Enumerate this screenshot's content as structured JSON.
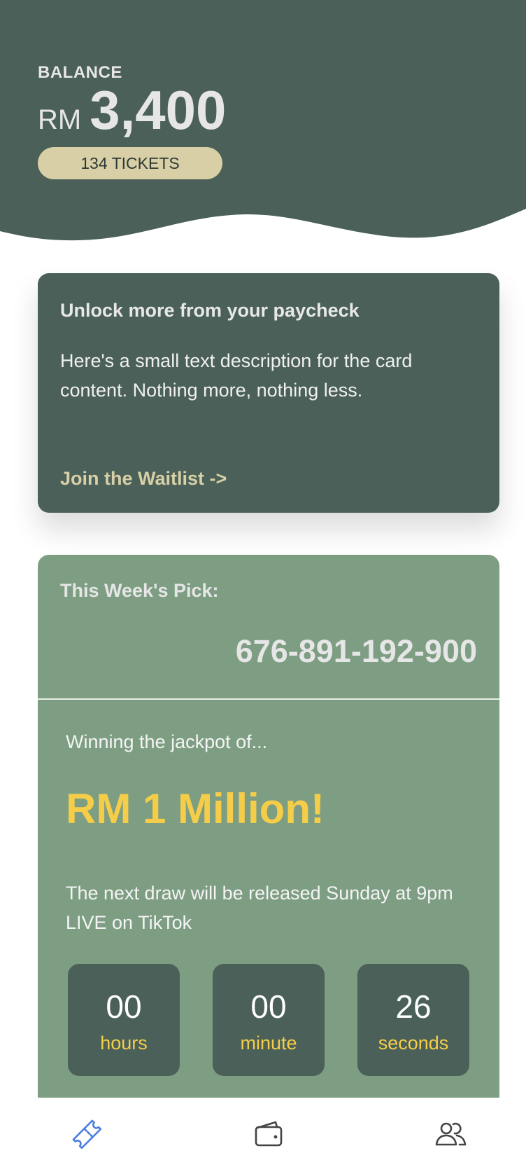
{
  "header": {
    "balance_label": "BALANCE",
    "currency": "RM",
    "amount": "3,400",
    "tickets": "134 TICKETS",
    "bg_color": "#4a6058"
  },
  "promo_card": {
    "title": "Unlock more from your paycheck",
    "description": "Here's a small text description for the card content. Nothing more, nothing less.",
    "link_label": "Join the Waitlist ->"
  },
  "pick_card": {
    "label": "This Week's Pick:",
    "number": "676-891-192-900",
    "jackpot_intro": "Winning the jackpot of...",
    "jackpot_amount": "RM 1 Million!",
    "draw_info": "The next draw will be released Sunday at 9pm LIVE on TikTok",
    "countdown": [
      {
        "value": "00",
        "unit": "hours"
      },
      {
        "value": "00",
        "unit": "minute"
      },
      {
        "value": "26",
        "unit": "seconds"
      }
    ]
  },
  "bottom_nav": {
    "items": [
      {
        "icon": "ticket-icon",
        "active": true
      },
      {
        "icon": "wallet-icon",
        "active": false
      },
      {
        "icon": "users-icon",
        "active": false
      }
    ]
  },
  "colors": {
    "primary_dark": "#4a6058",
    "card_green": "#7e9e83",
    "accent_sand": "#d8cfa6",
    "accent_yellow": "#f5cd48",
    "nav_active": "#4a7fe0",
    "nav_inactive": "#444444"
  }
}
